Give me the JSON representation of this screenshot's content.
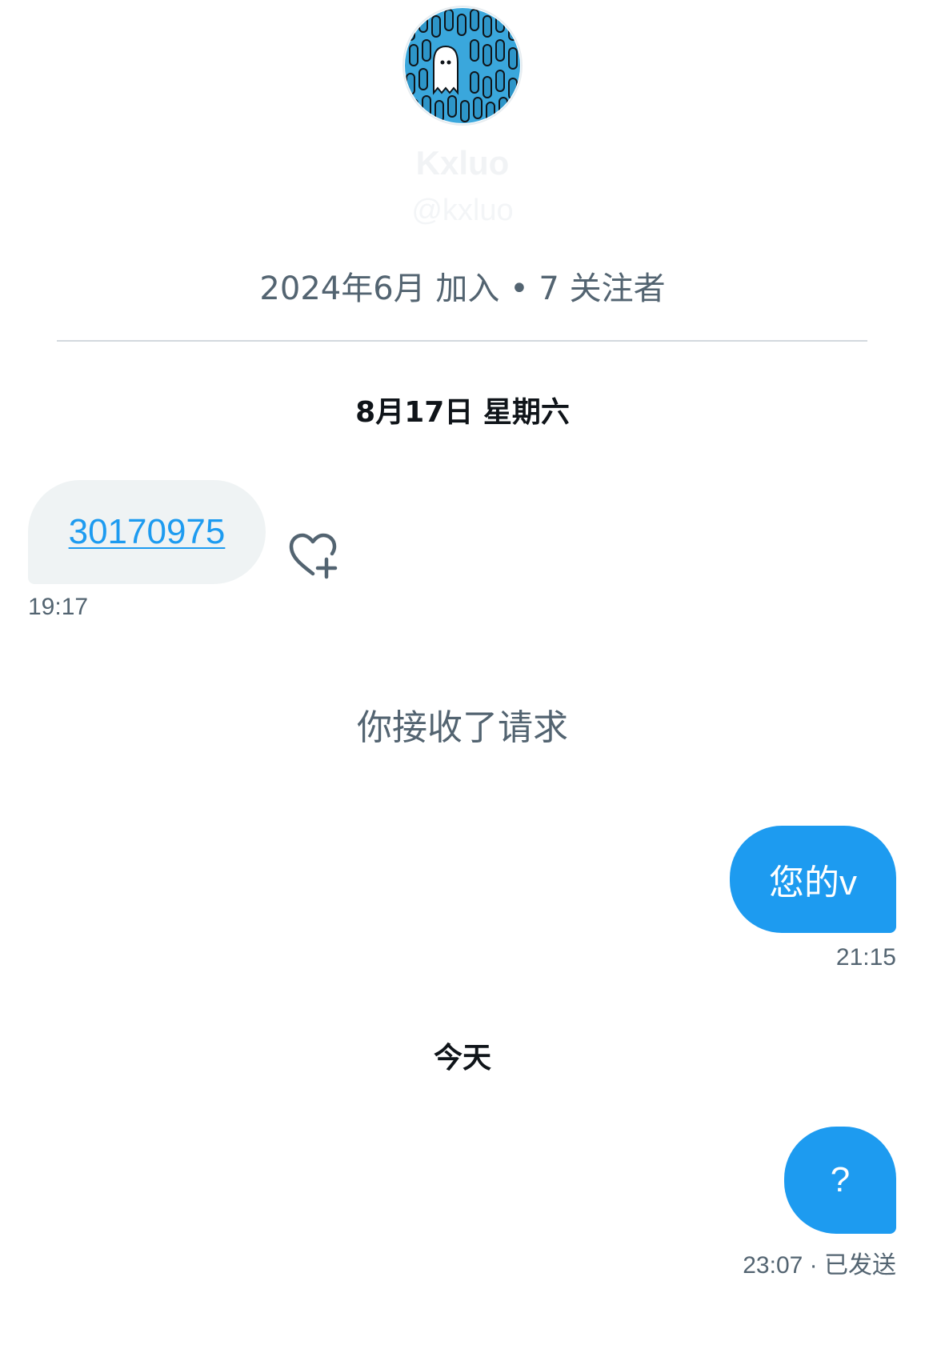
{
  "profile": {
    "display_name": "Kxluo",
    "handle": "@kxluo",
    "meta": "2024年6月 加入 • 7 关注者"
  },
  "conversation": {
    "date_separator_1": "8月17日 星期六",
    "incoming": {
      "text": "30170975",
      "time": "19:17",
      "reaction_icon": "heart-plus-icon"
    },
    "system_message": "你接收了请求",
    "outgoing_1": {
      "text": "您的v",
      "time": "21:15"
    },
    "date_separator_2": "今天",
    "outgoing_2": {
      "text": "?",
      "time": "23:07",
      "status": "· 已发送"
    }
  },
  "colors": {
    "accent": "#1d9bf0",
    "secondary_text": "#536471",
    "bubble_incoming": "#eff3f4"
  }
}
